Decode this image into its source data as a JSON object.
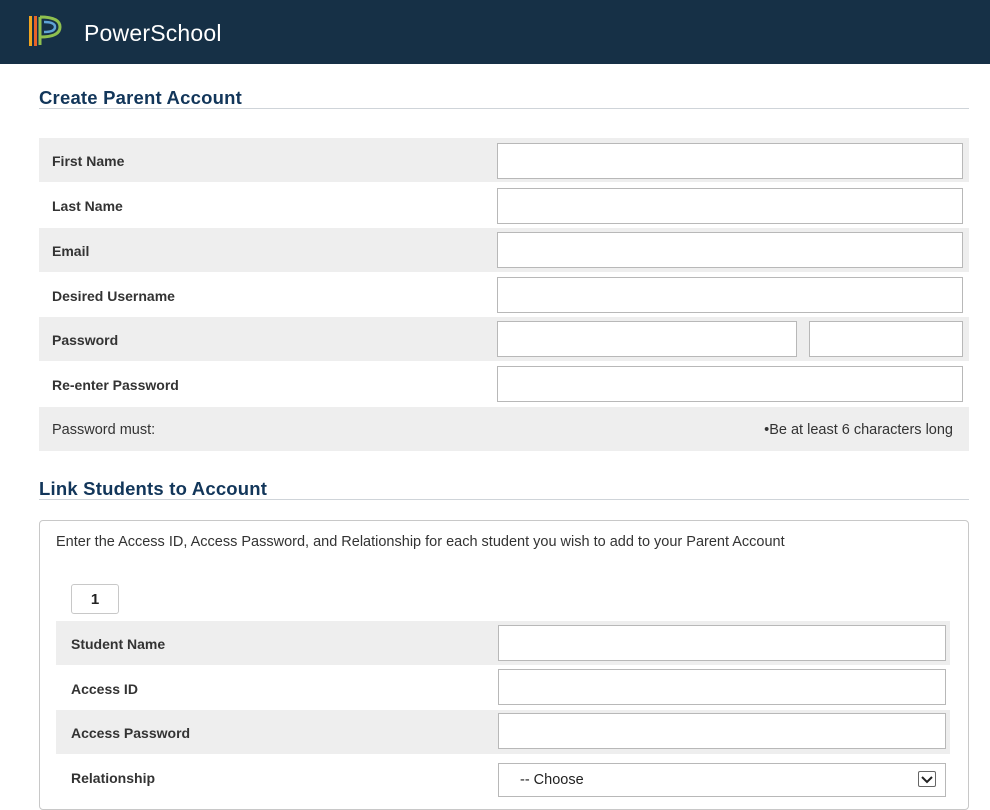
{
  "header": {
    "app_name": "PowerSchool",
    "logo_icon": "powerschool-logo"
  },
  "create_account": {
    "title": "Create Parent Account",
    "fields": [
      {
        "label": "First Name",
        "value": ""
      },
      {
        "label": "Last Name",
        "value": ""
      },
      {
        "label": "Email",
        "value": ""
      },
      {
        "label": "Desired Username",
        "value": ""
      },
      {
        "label": "Password",
        "value": ""
      },
      {
        "label": "Re-enter Password",
        "value": ""
      }
    ],
    "password_rule_label": "Password must:",
    "password_rule": "•Be at least 6 characters long"
  },
  "link_students": {
    "title": "Link Students to Account",
    "instructions": "Enter the Access ID, Access Password, and Relationship for each student you wish to add to your Parent Account",
    "student_number": "1",
    "fields": [
      {
        "label": "Student Name",
        "value": ""
      },
      {
        "label": "Access ID",
        "value": ""
      },
      {
        "label": "Access Password",
        "value": ""
      }
    ],
    "relationship": {
      "label": "Relationship",
      "selected": "-- Choose"
    }
  },
  "colors": {
    "header_bg": "#163046",
    "section_title": "#12365a",
    "row_shade": "#eeeeee"
  }
}
